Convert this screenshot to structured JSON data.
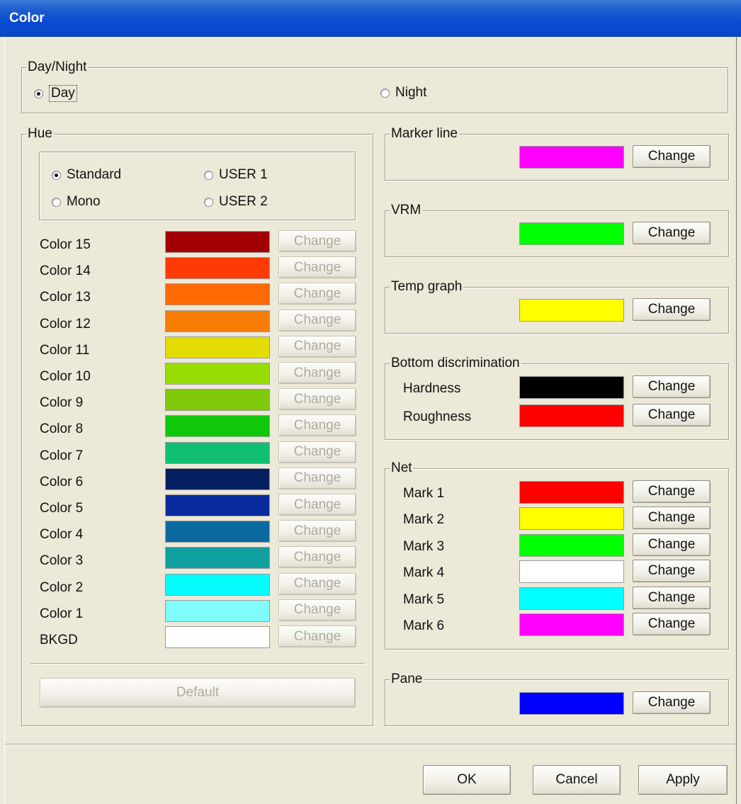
{
  "window": {
    "title": "Color"
  },
  "daynight": {
    "legend": "Day/Night",
    "options": [
      {
        "label": "Day",
        "checked": true
      },
      {
        "label": "Night",
        "checked": false
      }
    ]
  },
  "hue": {
    "legend": "Hue",
    "modes": [
      {
        "label": "Standard",
        "checked": true
      },
      {
        "label": "USER 1",
        "checked": false
      },
      {
        "label": "Mono",
        "checked": false
      },
      {
        "label": "USER 2",
        "checked": false
      }
    ],
    "rows": [
      {
        "label": "Color 15",
        "color": "#a10005",
        "button": "Change"
      },
      {
        "label": "Color 14",
        "color": "#ff3a05",
        "button": "Change"
      },
      {
        "label": "Color 13",
        "color": "#ff6a05",
        "button": "Change"
      },
      {
        "label": "Color 12",
        "color": "#f87d05",
        "button": "Change"
      },
      {
        "label": "Color 11",
        "color": "#e4dc05",
        "button": "Change"
      },
      {
        "label": "Color 10",
        "color": "#98dc05",
        "button": "Change"
      },
      {
        "label": "Color 9",
        "color": "#80c80a",
        "button": "Change"
      },
      {
        "label": "Color 8",
        "color": "#10c80a",
        "button": "Change"
      },
      {
        "label": "Color 7",
        "color": "#10c070",
        "button": "Change"
      },
      {
        "label": "Color 6",
        "color": "#052060",
        "button": "Change"
      },
      {
        "label": "Color 5",
        "color": "#0a2aa0",
        "button": "Change"
      },
      {
        "label": "Color 4",
        "color": "#0a6aa0",
        "button": "Change"
      },
      {
        "label": "Color 3",
        "color": "#10a0a0",
        "button": "Change"
      },
      {
        "label": "Color 2",
        "color": "#05fcfc",
        "button": "Change"
      },
      {
        "label": "Color 1",
        "color": "#80fcfc",
        "button": "Change"
      },
      {
        "label": "BKGD",
        "color": "#ffffff",
        "button": "Change"
      }
    ],
    "default_button": "Default"
  },
  "marker_line": {
    "legend": "Marker line",
    "color": "#ff00ff",
    "button": "Change"
  },
  "vrm": {
    "legend": "VRM",
    "color": "#00ff00",
    "button": "Change"
  },
  "temp_graph": {
    "legend": "Temp graph",
    "color": "#ffff00",
    "button": "Change"
  },
  "bottom": {
    "legend": "Bottom discrimination",
    "rows": [
      {
        "label": "Hardness",
        "color": "#000000",
        "button": "Change"
      },
      {
        "label": "Roughness",
        "color": "#ff0000",
        "button": "Change"
      }
    ]
  },
  "net": {
    "legend": "Net",
    "rows": [
      {
        "label": "Mark 1",
        "color": "#ff0000",
        "button": "Change"
      },
      {
        "label": "Mark 2",
        "color": "#ffff00",
        "button": "Change"
      },
      {
        "label": "Mark 3",
        "color": "#00ff00",
        "button": "Change"
      },
      {
        "label": "Mark 4",
        "color": "#ffffff",
        "button": "Change"
      },
      {
        "label": "Mark 5",
        "color": "#00ffff",
        "button": "Change"
      },
      {
        "label": "Mark 6",
        "color": "#ff00ff",
        "button": "Change"
      }
    ]
  },
  "pane": {
    "legend": "Pane",
    "color": "#0000ff",
    "button": "Change"
  },
  "footer": {
    "ok": "OK",
    "cancel": "Cancel",
    "apply": "Apply"
  }
}
